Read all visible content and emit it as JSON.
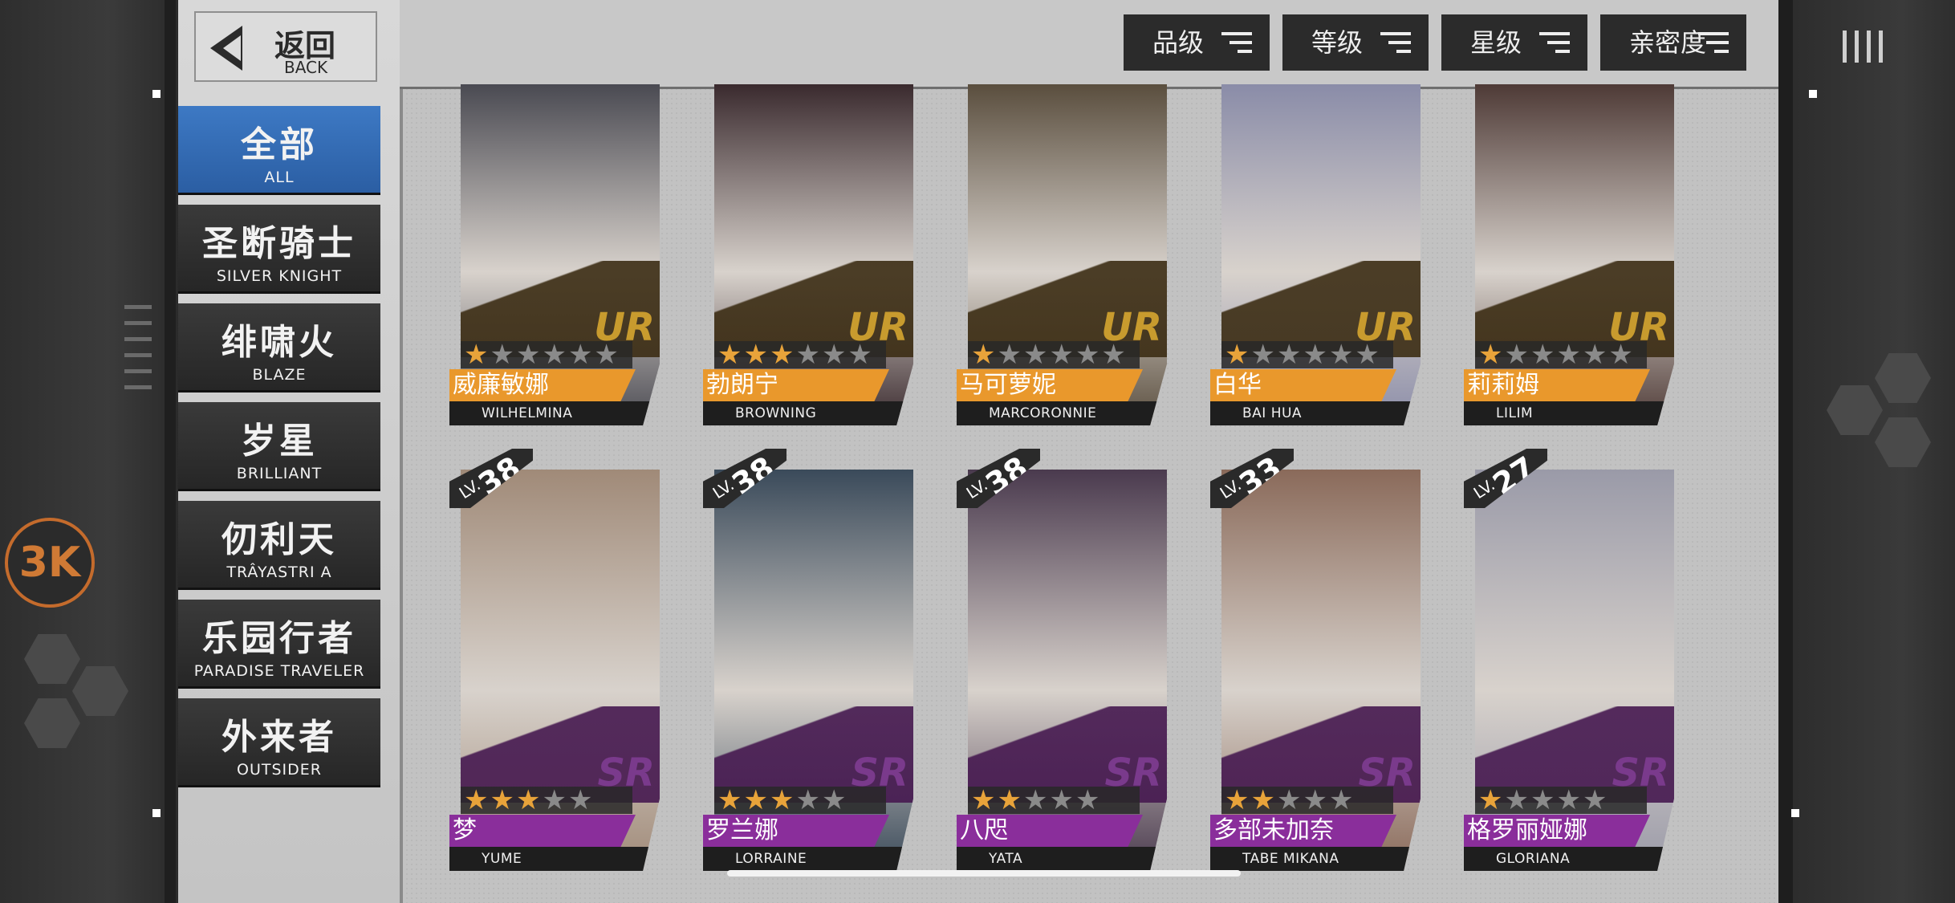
{
  "back": {
    "cn": "返回",
    "en": "BACK"
  },
  "logo": {
    "text": "3K"
  },
  "categories": [
    {
      "cn": "全部",
      "en": "ALL",
      "active": true
    },
    {
      "cn": "圣断骑士",
      "en": "SILVER KNIGHT",
      "active": false
    },
    {
      "cn": "绯啸火",
      "en": "BLAZE",
      "active": false
    },
    {
      "cn": "岁星",
      "en": "BRILLIANT",
      "active": false
    },
    {
      "cn": "仞利天",
      "en": "TRÂYASTRI A",
      "active": false
    },
    {
      "cn": "乐园行者",
      "en": "PARADISE TRAVELER",
      "active": false
    },
    {
      "cn": "外来者",
      "en": "OUTSIDER",
      "active": false
    }
  ],
  "sort_buttons": [
    "品级",
    "等级",
    "星级",
    "亲密度"
  ],
  "colors": {
    "ur_gold": "#c89b2e",
    "ur_name": "#e9982c",
    "sr_purple": "#7a3a8c",
    "sr_name": "#8a2e9b",
    "active_blue": "#2b5ea3"
  },
  "characters": [
    {
      "cn": "威廉敏娜",
      "en": "WILHELMINA",
      "rarity": "UR",
      "stars": 1,
      "max_stars": 6,
      "level": null,
      "art": "#4a4a52"
    },
    {
      "cn": "勃朗宁",
      "en": "BROWNING",
      "rarity": "UR",
      "stars": 3,
      "max_stars": 6,
      "level": null,
      "art": "#3a2a2e"
    },
    {
      "cn": "马可萝妮",
      "en": "MARCORONNIE",
      "rarity": "UR",
      "stars": 1,
      "max_stars": 6,
      "level": null,
      "art": "#5a4e3e"
    },
    {
      "cn": "白华",
      "en": "BAI HUA",
      "rarity": "UR",
      "stars": 1,
      "max_stars": 6,
      "level": null,
      "art": "#8a8ca8"
    },
    {
      "cn": "莉莉姆",
      "en": "LILIM",
      "rarity": "UR",
      "stars": 1,
      "max_stars": 6,
      "level": null,
      "art": "#4e3a36"
    },
    {
      "cn": "梦",
      "en": "YUME",
      "rarity": "SR",
      "stars": 3,
      "max_stars": 5,
      "level": "38",
      "art": "#a08a78"
    },
    {
      "cn": "罗兰娜",
      "en": "LORRAINE",
      "rarity": "SR",
      "stars": 3,
      "max_stars": 5,
      "level": "38",
      "art": "#3a4a5a"
    },
    {
      "cn": "八咫",
      "en": "YATA",
      "rarity": "SR",
      "stars": 2,
      "max_stars": 5,
      "level": "38",
      "art": "#4a3a4e"
    },
    {
      "cn": "多部未加奈",
      "en": "TABE MIKANA",
      "rarity": "SR",
      "stars": 2,
      "max_stars": 5,
      "level": "33",
      "art": "#8a6a5a"
    },
    {
      "cn": "格罗丽娅娜",
      "en": "GLORIANA",
      "rarity": "SR",
      "stars": 1,
      "max_stars": 5,
      "level": "27",
      "art": "#9a9aa8"
    }
  ]
}
